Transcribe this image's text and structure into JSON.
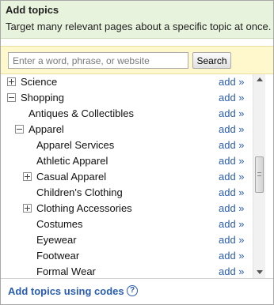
{
  "header": {
    "title": "Add topics",
    "subtitle": "Target many relevant pages about a specific topic at once."
  },
  "search": {
    "placeholder": "Enter a word, phrase, or website",
    "value": "",
    "button_label": "Search"
  },
  "topics": {
    "add_label": "add »",
    "rows": [
      {
        "label": "Science",
        "toggle": "plus",
        "level": 0
      },
      {
        "label": "Shopping",
        "toggle": "minus",
        "level": 0
      },
      {
        "label": "Antiques & Collectibles",
        "toggle": "none",
        "level": 1
      },
      {
        "label": "Apparel",
        "toggle": "minus",
        "level": 1
      },
      {
        "label": "Apparel Services",
        "toggle": "none",
        "level": 2
      },
      {
        "label": "Athletic Apparel",
        "toggle": "none",
        "level": 2
      },
      {
        "label": "Casual Apparel",
        "toggle": "plus",
        "level": 2
      },
      {
        "label": "Children's Clothing",
        "toggle": "none",
        "level": 2
      },
      {
        "label": "Clothing Accessories",
        "toggle": "plus",
        "level": 2
      },
      {
        "label": "Costumes",
        "toggle": "none",
        "level": 2
      },
      {
        "label": "Eyewear",
        "toggle": "none",
        "level": 2
      },
      {
        "label": "Footwear",
        "toggle": "none",
        "level": 2
      },
      {
        "label": "Formal Wear",
        "toggle": "none",
        "level": 2
      }
    ]
  },
  "footer": {
    "link_label": "Add topics using codes",
    "help_glyph": "?"
  },
  "icons": {
    "expand": "plus-box-icon",
    "collapse": "minus-box-icon",
    "help": "question-circle-icon",
    "scroll_up": "arrow-up-icon",
    "scroll_down": "arrow-down-icon"
  },
  "colors": {
    "header_bg": "#e8f3dd",
    "search_bg": "#fff8cc",
    "link": "#2a5db0"
  }
}
